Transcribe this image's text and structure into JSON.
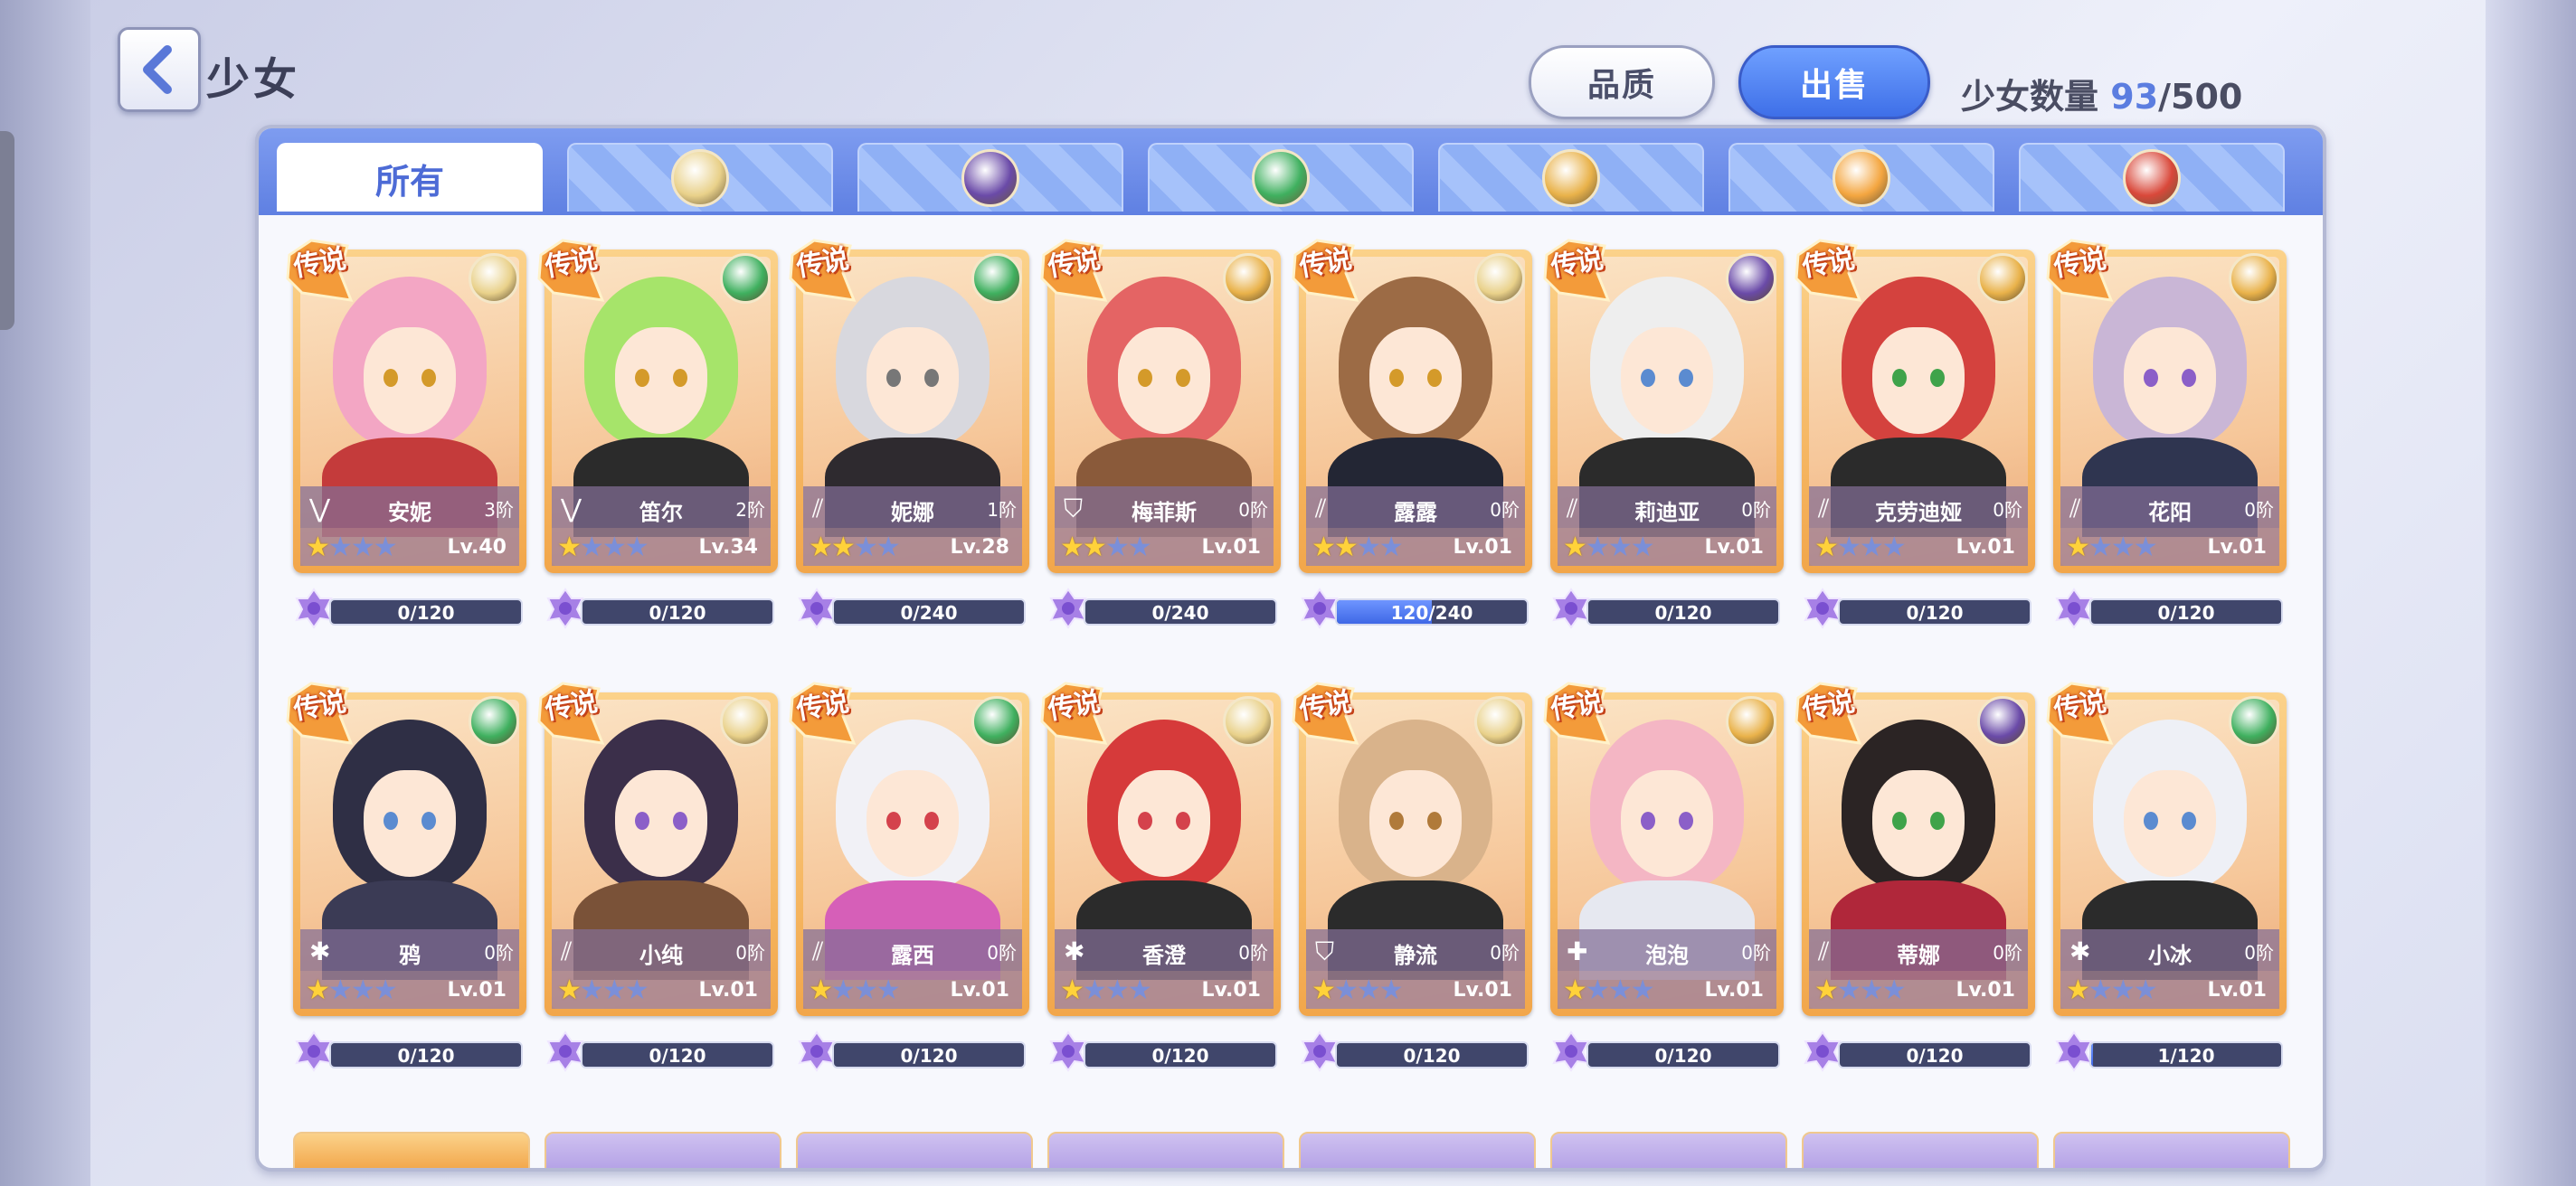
{
  "header": {
    "title": "少女",
    "quality_label": "品质",
    "sell_label": "出售",
    "count_label": "少女数量",
    "count_current": "93",
    "count_max": "/500"
  },
  "tabs": [
    {
      "label": "所有",
      "active": true
    },
    {
      "icon": "radiant-element-icon",
      "color": "#e9d18a"
    },
    {
      "icon": "dark-element-icon",
      "color": "#6a4aa8"
    },
    {
      "icon": "wind-element-icon",
      "color": "#3fb05f"
    },
    {
      "icon": "hexagon-element-icon",
      "color": "#e9b24a"
    },
    {
      "icon": "sun-element-icon",
      "color": "#f4a640"
    },
    {
      "icon": "fire-element-icon",
      "color": "#d9483a"
    }
  ],
  "rarity_badge": "传说",
  "cards": [
    {
      "name": "安妮",
      "rank": "3阶",
      "level": "Lv.40",
      "stars": 1,
      "progress": "0/120",
      "fill": 0,
      "class_glyph": "⋁",
      "element": "#e9d18a",
      "hair": "#f3a6c4",
      "outfit": "#c43b3b",
      "eye": "#d49a2a"
    },
    {
      "name": "笛尔",
      "rank": "2阶",
      "level": "Lv.34",
      "stars": 1,
      "progress": "0/120",
      "fill": 0,
      "class_glyph": "⋁",
      "element": "#3fb05f",
      "hair": "#a6e46a",
      "outfit": "#2b2b2b",
      "eye": "#d49a2a"
    },
    {
      "name": "妮娜",
      "rank": "1阶",
      "level": "Lv.28",
      "stars": 2,
      "progress": "0/240",
      "fill": 0,
      "class_glyph": "⫽",
      "element": "#3fb05f",
      "hair": "#d8d8de",
      "outfit": "#2e2a2f",
      "eye": "#777"
    },
    {
      "name": "梅菲斯",
      "rank": "0阶",
      "level": "Lv.01",
      "stars": 2,
      "progress": "0/240",
      "fill": 0,
      "class_glyph": "⛉",
      "element": "#e9b24a",
      "hair": "#e46464",
      "outfit": "#8a5a3a",
      "eye": "#d49a2a"
    },
    {
      "name": "露露",
      "rank": "0阶",
      "level": "Lv.01",
      "stars": 2,
      "progress": "120/240",
      "fill": 0.5,
      "class_glyph": "⫽",
      "element": "#e9d18a",
      "hair": "#9c6b45",
      "outfit": "#232634",
      "eye": "#d49a2a"
    },
    {
      "name": "莉迪亚",
      "rank": "0阶",
      "level": "Lv.01",
      "stars": 1,
      "progress": "0/120",
      "fill": 0,
      "class_glyph": "⫽",
      "element": "#6a4aa8",
      "hair": "#eeeeee",
      "outfit": "#2b2b2b",
      "eye": "#5b8bd0"
    },
    {
      "name": "克劳迪娅",
      "rank": "0阶",
      "level": "Lv.01",
      "stars": 1,
      "progress": "0/120",
      "fill": 0,
      "class_glyph": "⫽",
      "element": "#e9b24a",
      "hair": "#d4423e",
      "outfit": "#2b2b2b",
      "eye": "#3fa34a"
    },
    {
      "name": "花阳",
      "rank": "0阶",
      "level": "Lv.01",
      "stars": 1,
      "progress": "0/120",
      "fill": 0,
      "class_glyph": "⫽",
      "element": "#e9b24a",
      "hair": "#c9b6d6",
      "outfit": "#2f3550",
      "eye": "#8b5fc8"
    },
    {
      "name": "鸦",
      "rank": "0阶",
      "level": "Lv.01",
      "stars": 1,
      "progress": "0/120",
      "fill": 0,
      "class_glyph": "✱",
      "element": "#3fb05f",
      "hair": "#2f2f45",
      "outfit": "#3b3b55",
      "eye": "#5b8bd0"
    },
    {
      "name": "小纯",
      "rank": "0阶",
      "level": "Lv.01",
      "stars": 1,
      "progress": "0/120",
      "fill": 0,
      "class_glyph": "⫽",
      "element": "#e9d18a",
      "hair": "#3b2f4a",
      "outfit": "#7a5238",
      "eye": "#8b5fc8"
    },
    {
      "name": "露西",
      "rank": "0阶",
      "level": "Lv.01",
      "stars": 1,
      "progress": "0/120",
      "fill": 0,
      "class_glyph": "⫽",
      "element": "#3fb05f",
      "hair": "#f1f1f6",
      "outfit": "#d65fb8",
      "eye": "#d4424c"
    },
    {
      "name": "香澄",
      "rank": "0阶",
      "level": "Lv.01",
      "stars": 1,
      "progress": "0/120",
      "fill": 0,
      "class_glyph": "✱",
      "element": "#e9d18a",
      "hair": "#d63a3a",
      "outfit": "#2b2b2b",
      "eye": "#d4424c"
    },
    {
      "name": "静流",
      "rank": "0阶",
      "level": "Lv.01",
      "stars": 1,
      "progress": "0/120",
      "fill": 0,
      "class_glyph": "⛉",
      "element": "#e9d18a",
      "hair": "#d9b38b",
      "outfit": "#2b2b2b",
      "eye": "#b07a3a"
    },
    {
      "name": "泡泡",
      "rank": "0阶",
      "level": "Lv.01",
      "stars": 1,
      "progress": "0/120",
      "fill": 0,
      "class_glyph": "✚",
      "element": "#e9b24a",
      "hair": "#f4b6c4",
      "outfit": "#e6e8f0",
      "eye": "#8b5fc8"
    },
    {
      "name": "蒂娜",
      "rank": "0阶",
      "level": "Lv.01",
      "stars": 1,
      "progress": "0/120",
      "fill": 0,
      "class_glyph": "⫽",
      "element": "#6a4aa8",
      "hair": "#2b2424",
      "outfit": "#b0273a",
      "eye": "#3fa34a"
    },
    {
      "name": "小冰",
      "rank": "0阶",
      "level": "Lv.01",
      "stars": 1,
      "progress": "1/120",
      "fill": 0.01,
      "class_glyph": "✱",
      "element": "#3fb05f",
      "hair": "#eef0f6",
      "outfit": "#2b2b2b",
      "eye": "#5b8bd0"
    }
  ]
}
